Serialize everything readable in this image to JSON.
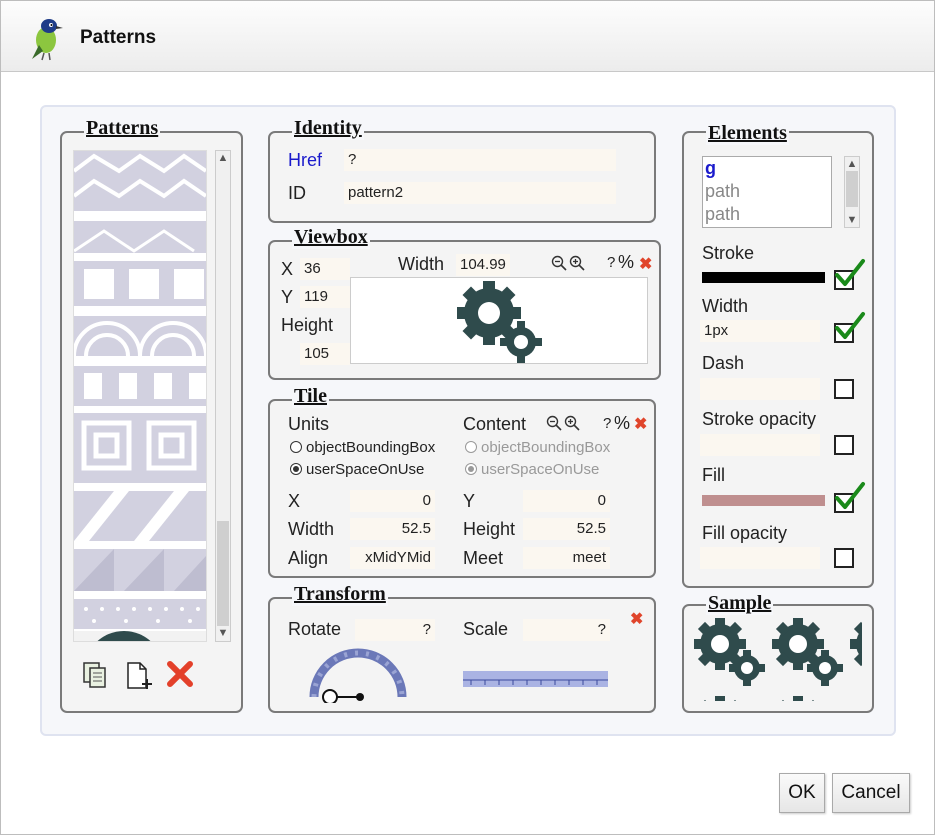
{
  "window": {
    "title": "Patterns"
  },
  "patterns_panel": {
    "legend": "Patterns"
  },
  "identity": {
    "legend": "Identity",
    "href_label": "Href",
    "href_value": "?",
    "id_label": "ID",
    "id_value": "pattern2"
  },
  "viewbox": {
    "legend": "Viewbox",
    "x_label": "X",
    "x_value": "36",
    "y_label": "Y",
    "y_value": "119",
    "height_label": "Height",
    "height_value": "105",
    "width_label": "Width",
    "width_value": "104.99",
    "unit_q": "?",
    "unit_pct": "%"
  },
  "tile": {
    "legend": "Tile",
    "units_label": "Units",
    "content_label": "Content",
    "unit_q": "?",
    "unit_pct": "%",
    "units_options": [
      "objectBoundingBox",
      "userSpaceOnUse"
    ],
    "content_options": [
      "objectBoundingBox",
      "userSpaceOnUse"
    ],
    "x_label": "X",
    "x_value": "0",
    "y_label": "Y",
    "y_value": "0",
    "width_label": "Width",
    "width_value": "52.5",
    "height_label": "Height",
    "height_value": "52.5",
    "align_label": "Align",
    "align_value": "xMidYMid",
    "meet_label": "Meet",
    "meet_value": "meet"
  },
  "transform": {
    "legend": "Transform",
    "rotate_label": "Rotate",
    "rotate_value": "?",
    "scale_label": "Scale",
    "scale_value": "?"
  },
  "elements": {
    "legend": "Elements",
    "items": [
      "g",
      "path",
      "path"
    ],
    "stroke_label": "Stroke",
    "stroke_color": "#000000",
    "width_label": "Width",
    "width_value": "1px",
    "dash_label": "Dash",
    "stroke_opacity_label": "Stroke opacity",
    "fill_label": "Fill",
    "fill_color": "#bf8f8f",
    "fill_opacity_label": "Fill opacity"
  },
  "sample": {
    "legend": "Sample"
  },
  "buttons": {
    "ok": "OK",
    "cancel": "Cancel"
  },
  "colors": {
    "gear": "#2f4b4c",
    "pattern": "#d2d1e0",
    "accent_blue": "#1a1acc"
  }
}
